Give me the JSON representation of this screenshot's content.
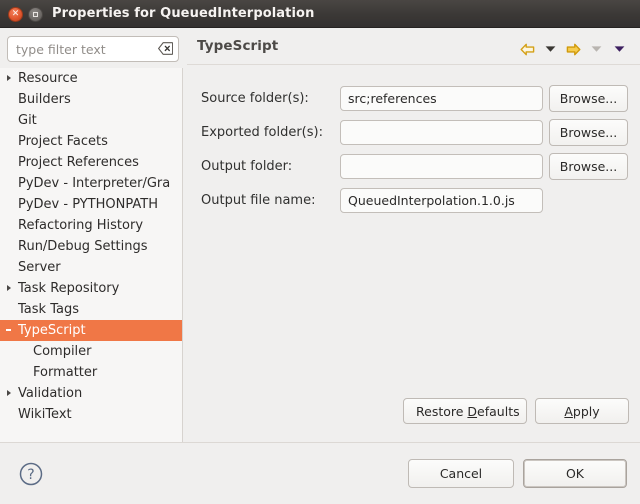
{
  "window": {
    "title": "Properties for QueuedInterpolation",
    "close_icon": "close-icon",
    "maximize_icon": "maximize-icon"
  },
  "sidebar": {
    "filter": {
      "placeholder": "type filter text",
      "value": "",
      "clear_icon": "clear-backspace-icon"
    },
    "items": [
      {
        "label": "Resource",
        "expandable": true,
        "indent": 0,
        "selected": false
      },
      {
        "label": "Builders",
        "expandable": false,
        "indent": 0,
        "selected": false
      },
      {
        "label": "Git",
        "expandable": false,
        "indent": 0,
        "selected": false
      },
      {
        "label": "Project Facets",
        "expandable": false,
        "indent": 0,
        "selected": false
      },
      {
        "label": "Project References",
        "expandable": false,
        "indent": 0,
        "selected": false
      },
      {
        "label": "PyDev - Interpreter/Gra",
        "expandable": false,
        "indent": 0,
        "selected": false
      },
      {
        "label": "PyDev - PYTHONPATH",
        "expandable": false,
        "indent": 0,
        "selected": false
      },
      {
        "label": "Refactoring History",
        "expandable": false,
        "indent": 0,
        "selected": false
      },
      {
        "label": "Run/Debug Settings",
        "expandable": false,
        "indent": 0,
        "selected": false
      },
      {
        "label": "Server",
        "expandable": false,
        "indent": 0,
        "selected": false
      },
      {
        "label": "Task Repository",
        "expandable": true,
        "indent": 0,
        "selected": false
      },
      {
        "label": "Task Tags",
        "expandable": false,
        "indent": 0,
        "selected": false
      },
      {
        "label": "TypeScript",
        "expandable": true,
        "indent": 0,
        "selected": true
      },
      {
        "label": "Compiler",
        "expandable": false,
        "indent": 1,
        "selected": false
      },
      {
        "label": "Formatter",
        "expandable": false,
        "indent": 1,
        "selected": false
      },
      {
        "label": "Validation",
        "expandable": true,
        "indent": 0,
        "selected": false
      },
      {
        "label": "WikiText",
        "expandable": false,
        "indent": 0,
        "selected": false
      }
    ]
  },
  "content": {
    "page_title": "TypeScript",
    "nav": [
      {
        "name": "back-arrow-icon",
        "kind": "arrow-left",
        "enabled": true
      },
      {
        "name": "back-history-dropdown-icon",
        "kind": "caret",
        "enabled": true
      },
      {
        "name": "forward-arrow-icon",
        "kind": "arrow-right",
        "enabled": true
      },
      {
        "name": "forward-history-dropdown-icon",
        "kind": "caret",
        "enabled": false
      },
      {
        "name": "view-menu-dropdown-icon",
        "kind": "caret-dark",
        "enabled": true
      }
    ],
    "fields": [
      {
        "label": "Source folder(s):",
        "value": "src;references",
        "placeholder": "",
        "browse_label": "Browse...",
        "has_browse": true,
        "width": "wide"
      },
      {
        "label": "Exported folder(s):",
        "value": "",
        "placeholder": "",
        "browse_label": "Browse...",
        "has_browse": true,
        "width": "wide"
      },
      {
        "label": "Output folder:",
        "value": "",
        "placeholder": "",
        "browse_label": "Browse...",
        "has_browse": true,
        "width": "wide"
      },
      {
        "label": "Output file name:",
        "value": "QueuedInterpolation.1.0.js",
        "placeholder": "",
        "browse_label": "",
        "has_browse": false,
        "width": "narrow"
      }
    ],
    "restore_defaults": {
      "pre": "Restore ",
      "mnemonic": "D",
      "post": "efaults"
    },
    "apply": {
      "pre": "",
      "mnemonic": "A",
      "post": "pply"
    }
  },
  "footer": {
    "help_icon": "help-question-icon",
    "cancel_label": "Cancel",
    "ok_label": "OK"
  },
  "colors": {
    "selection": "#f07746",
    "titlebar": "#3b3836",
    "dialog_bg": "#f0efee",
    "tree_bg": "#f7f6f5",
    "arrow_gold": "#d9a300"
  }
}
